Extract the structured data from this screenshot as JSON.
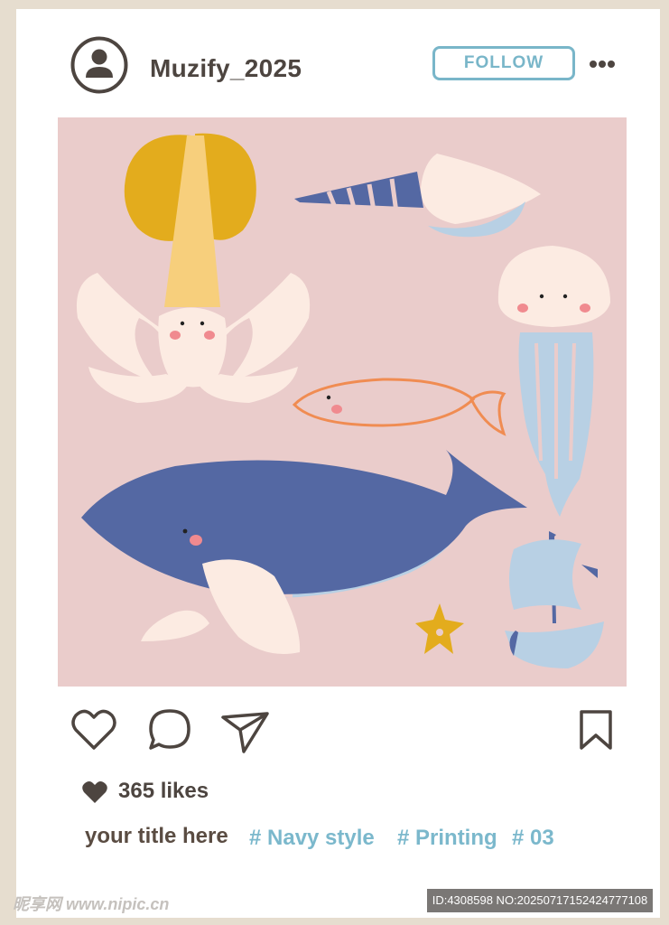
{
  "post": {
    "username": "Muzify_2025",
    "follow_label": "FOLLOW",
    "likes_text": "365 likes",
    "caption_title": "your title here",
    "tags": [
      "# Navy style",
      "# Printing",
      "# 03"
    ]
  },
  "icons": {
    "avatar": "user-avatar-icon",
    "more": "more-dots-icon",
    "like": "heart-icon",
    "comment": "comment-bubble-icon",
    "share": "paper-plane-icon",
    "save": "bookmark-icon",
    "likes": "heart-filled-icon"
  },
  "colors": {
    "frame": "#e6ddcf",
    "image_background": "#eacccb",
    "follow_accent": "#79b6c9",
    "tag_color": "#7bb8cc",
    "text_dark": "#4d4540",
    "whale_blue": "#5468a3",
    "light_blue": "#b8d0e4",
    "mustard": "#e3ac1d",
    "cream": "#fcebe2",
    "orange": "#f08c52"
  },
  "watermark": {
    "site": "昵享网 www.nipic.cn",
    "id_text": "ID:4308598 NO:20250717152424777108"
  }
}
